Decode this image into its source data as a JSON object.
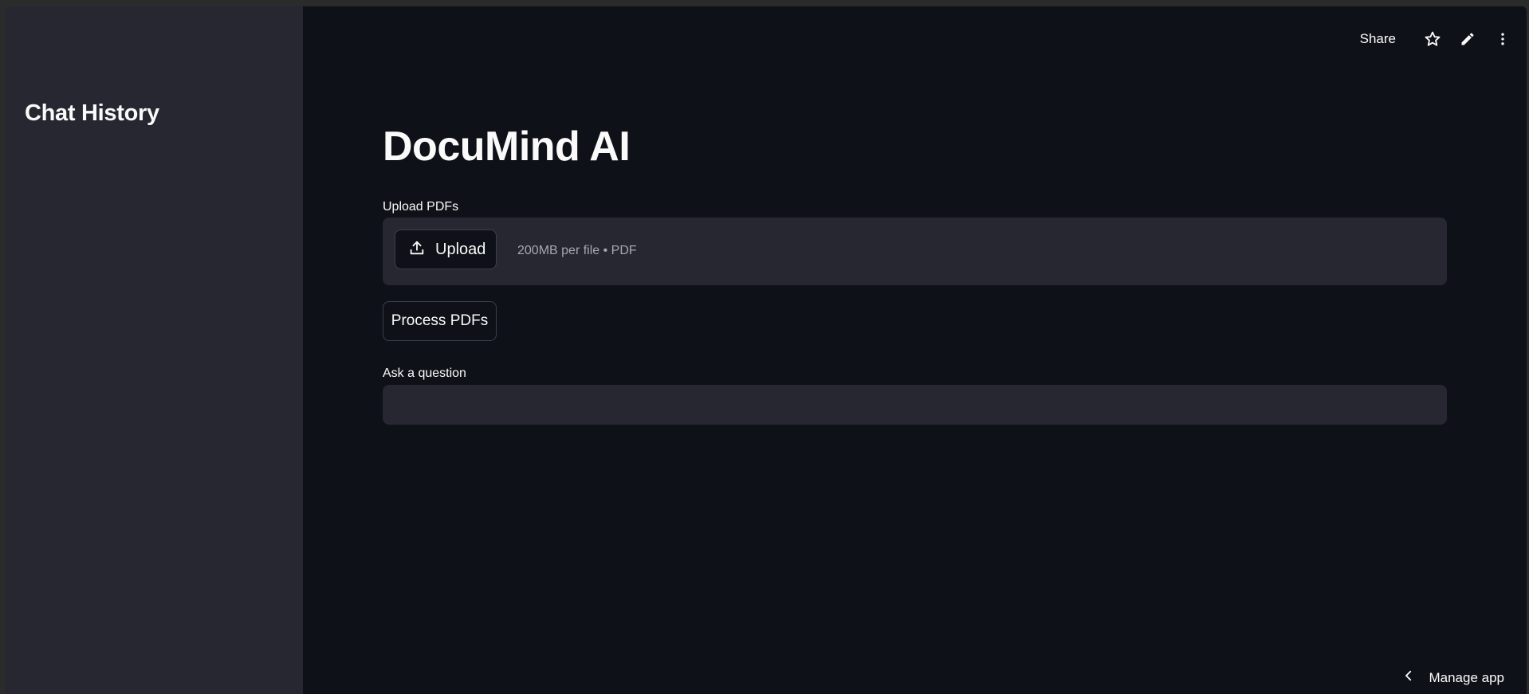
{
  "sidebar": {
    "title": "Chat History"
  },
  "toolbar": {
    "share_label": "Share",
    "icons": [
      "star-icon",
      "pencil-icon",
      "more-vertical-icon"
    ]
  },
  "main": {
    "title": "DocuMind AI",
    "upload": {
      "label": "Upload PDFs",
      "button_label": "Upload",
      "hint": "200MB per file • PDF"
    },
    "process_button_label": "Process PDFs",
    "question": {
      "label": "Ask a question",
      "value": "",
      "placeholder": ""
    }
  },
  "footer": {
    "manage_app_label": "Manage app"
  },
  "colors": {
    "background": "#0e1117",
    "sidebar": "#262730",
    "input_background": "#262730",
    "text": "#fafafa",
    "muted_text": "#a3a8b4",
    "border": "#3d3f4b"
  }
}
